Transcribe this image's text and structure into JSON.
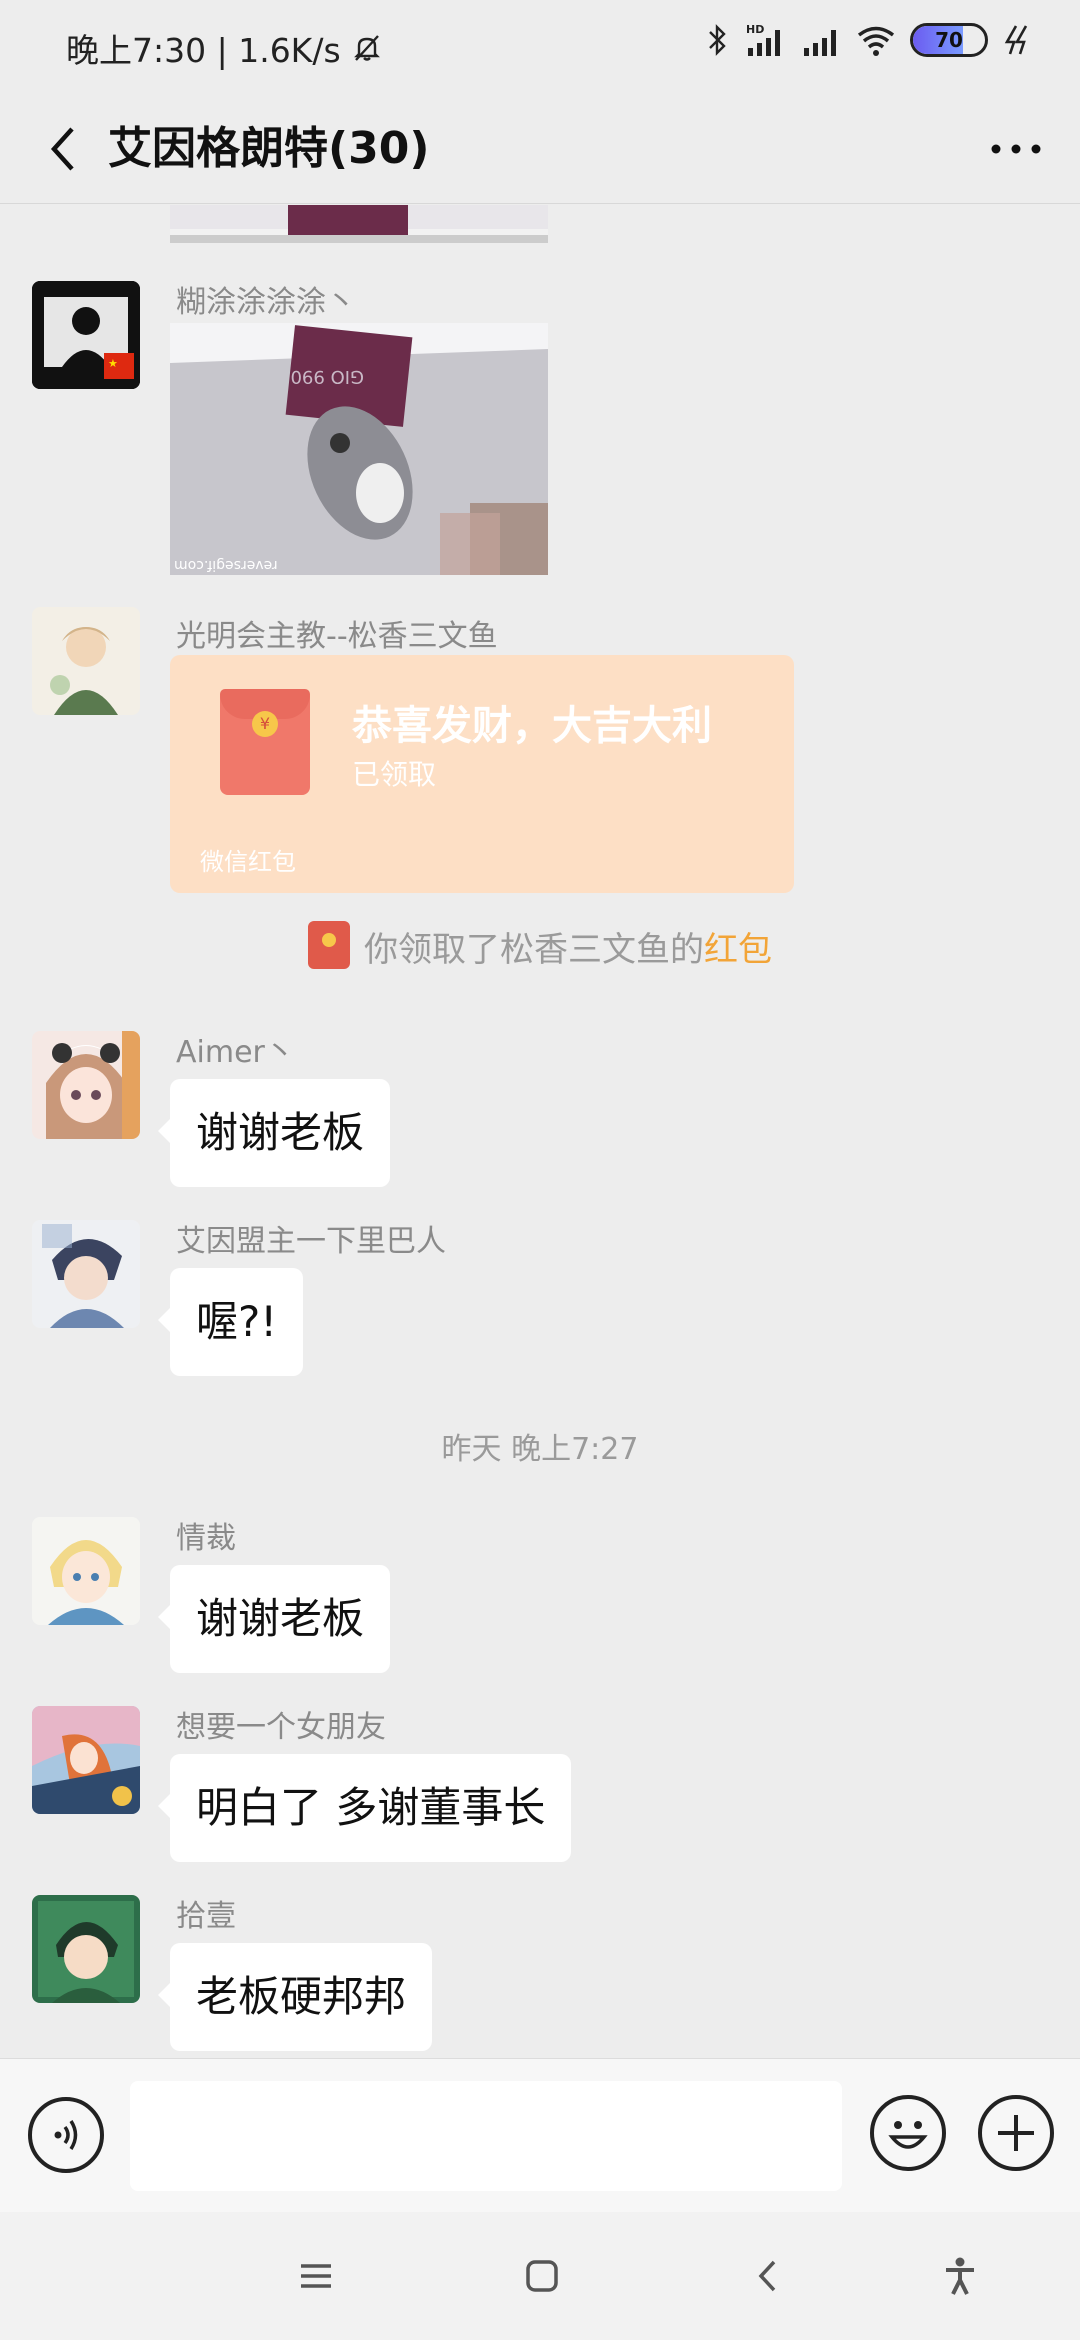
{
  "status_bar": {
    "time_speed": "晚上7:30 | 1.6K/s",
    "battery": "70",
    "battery_level": 0.7
  },
  "header": {
    "title": "艾因格朗特(30)"
  },
  "messages": [
    {
      "type": "image",
      "sender": "",
      "caption": ""
    },
    {
      "type": "image",
      "sender": "糊涂涂涂涂丶",
      "image_text": "reversegif.com"
    },
    {
      "type": "red_packet",
      "sender": "光明会主教--松香三文鱼",
      "title": "恭喜发财，大吉大利",
      "status": "已领取",
      "footer": "微信红包"
    },
    {
      "type": "system",
      "text_prefix": "你领取了松香三文鱼的",
      "text_highlight": "红包"
    },
    {
      "type": "text",
      "sender": "Aimer丶",
      "text": "谢谢老板"
    },
    {
      "type": "text",
      "sender": "艾因盟主一下里巴人",
      "text": "喔?!"
    },
    {
      "type": "time",
      "text": "昨天 晚上7:27"
    },
    {
      "type": "text",
      "sender": "情裁",
      "text": "谢谢老板"
    },
    {
      "type": "text",
      "sender": "想要一个女朋友",
      "text": "明白了 多谢董事长"
    },
    {
      "type": "text",
      "sender": "拾壹",
      "text": "老板硬邦邦"
    }
  ],
  "input": {
    "placeholder": ""
  },
  "colors": {
    "background": "#ededed",
    "red_packet": "#fddfc5",
    "highlight": "#f2a437"
  },
  "icons": {
    "back": "chevron-left-icon",
    "more": "more-dots-icon",
    "voice": "voice-icon",
    "emoji": "emoji-icon",
    "plus": "plus-icon"
  }
}
